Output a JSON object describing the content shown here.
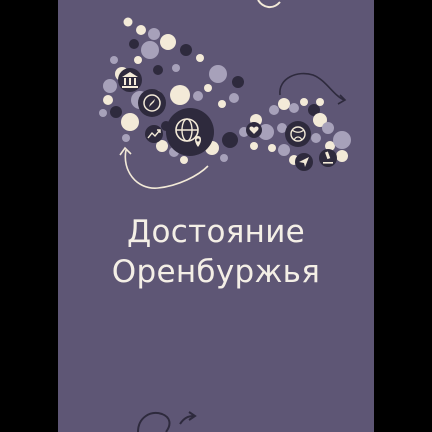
{
  "title": {
    "line1": "Достояние",
    "line2": "Оренбуржья"
  },
  "colors": {
    "background": "#5e5675",
    "outer": "#000000",
    "dark_dot": "#2e2a3d",
    "light_dot": "#a7a1ba",
    "cream_dot": "#f3ead8",
    "text": "#f4efe6"
  },
  "icons": [
    "museum-icon",
    "compass-icon",
    "trend-icon",
    "globe-location-icon",
    "ball-icon",
    "heart-icon",
    "scissors-icon",
    "navigation-icon",
    "microscope-icon"
  ]
}
